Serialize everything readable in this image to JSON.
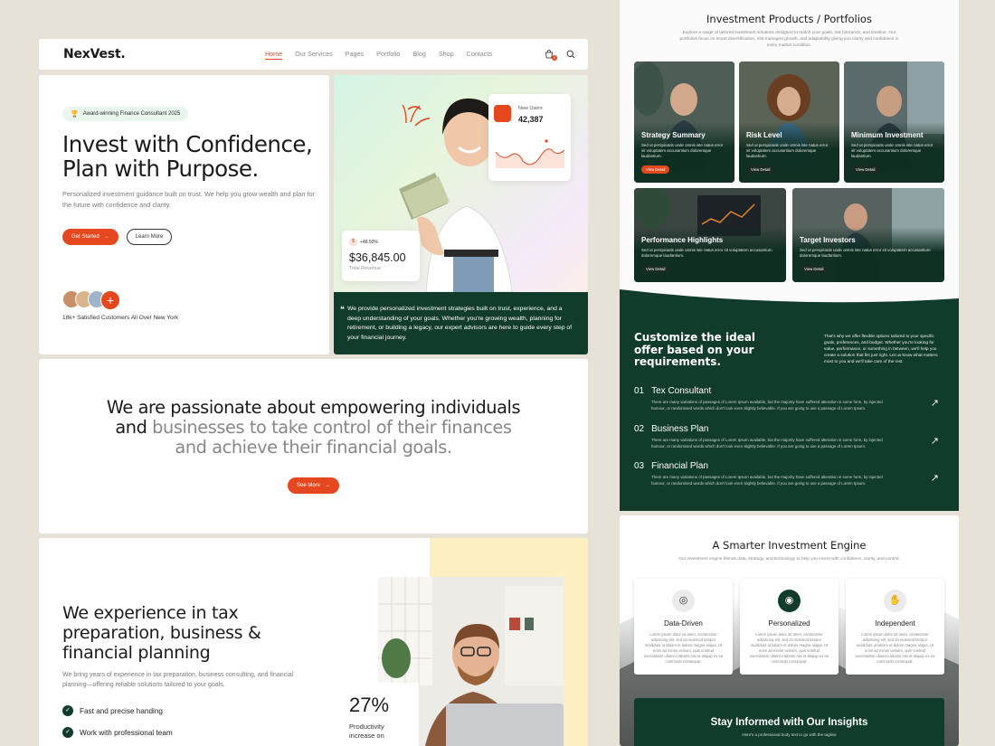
{
  "nav": {
    "logo": "NexVest.",
    "items": [
      {
        "label": "Home",
        "active": true
      },
      {
        "label": "Our Services"
      },
      {
        "label": "Pages"
      },
      {
        "label": "Portfolio"
      },
      {
        "label": "Blog"
      },
      {
        "label": "Shop"
      },
      {
        "label": "Contacts"
      }
    ],
    "cart_count": "0"
  },
  "hero": {
    "badge": "Award-winning Finance Consultant 2025",
    "title_line1": "Invest with Confidence,",
    "title_line2": "Plan with Purpose.",
    "subtitle": "Personalized investment guidance built on trust. We help you grow wealth and plan for the future with confidence and clarity.",
    "primary_btn": "Get Started",
    "secondary_btn": "Learn More",
    "plus_label": "+",
    "customers": "18k+ Satisfied Customers All Over New York",
    "new_users_label": "New Users",
    "new_users_value": "42,387",
    "growth": "+48.50%",
    "coin": "$",
    "revenue": "$36,845.00",
    "revenue_label": "Total Revenue",
    "quote": "We provide personalized investment strategies built on trust, experience, and a deep understanding of your goals. Whether you're growing wealth, planning for retirement, or building a legacy, our expert advisors are here to guide every step of your financial journey."
  },
  "mission": {
    "dark1": "We are passionate about empowering individuals",
    "dark2": "and ",
    "grey2": "businesses to take control of their finances",
    "grey3": "and achieve their financial goals.",
    "btn": "See More"
  },
  "tax": {
    "title_line1": "We experience in tax",
    "title_line2": "preparation, business &",
    "title_line3": "financial planning",
    "subtitle": "We bring years of experience in tax preparation, business consulting, and financial planning—offering reliable solutions tailored to your goals.",
    "checks": [
      "Fast and precise handing",
      "Work with professional team"
    ],
    "stat": "27%",
    "stat_label": "Productivity increase on"
  },
  "products": {
    "title": "Investment Products / Portfolios",
    "subtitle": "Explore a range of tailored investment solutions designed to match your goals, risk tolerance, and timeline. Our portfolios focus on smart diversification, risk-managed growth, and adaptability giving you clarity and confidence in every market condition.",
    "cards": [
      {
        "title": "Strategy Summary",
        "desc": "Sed ut perspiciatis unde omnis iste natus error sit voluptatem accusantium doloremque laudantium.",
        "btn": "View Detail"
      },
      {
        "title": "Risk Level",
        "desc": "Sed ut perspiciatis unde omnis iste natus error sit voluptatem accusantium doloremque laudantium.",
        "btn": "View Detail"
      },
      {
        "title": "Minimum Investment",
        "desc": "Sed ut perspiciatis unde omnis iste natus error sit voluptatem accusantium doloremque laudantium.",
        "btn": "View Detail"
      },
      {
        "title": "Performance Highlights",
        "desc": "Sed ut perspiciatis unde omnis iste natus error sit voluptatem accusantium doloremque laudantium.",
        "btn": "View Detail"
      },
      {
        "title": "Target Investors",
        "desc": "Sed ut perspiciatis unde omnis iste natus error sit voluptatem accusantium doloremque laudantium.",
        "btn": "View Detail"
      }
    ]
  },
  "offer": {
    "title": "Customize the ideal offer based on your requirements.",
    "note": "That's why we offer flexible options tailored to your specific goals, preferences, and budget. Whether you're looking for value, performance, or something in between, we'll help you create a solution that fits just right. Let us know what matters most to you and we'll take care of the rest.",
    "items": [
      {
        "num": "01",
        "title": "Tex Consultant",
        "desc": "There are many variations of passages of Lorem Ipsum available, but the majority have suffered alteration in some form, by injected humour, or randomised words which don't look even slightly believable. If you are going to use a passage of Lorem Ipsum."
      },
      {
        "num": "02",
        "title": "Business Plan",
        "desc": "There are many variations of passages of Lorem Ipsum available, but the majority have suffered alteration in some form, by injected humour, or randomised words which don't look even slightly believable. If you are going to use a passage of Lorem Ipsum."
      },
      {
        "num": "03",
        "title": "Financial Plan",
        "desc": "There are many variations of passages of Lorem Ipsum available, but the majority have suffered alteration in some form, by injected humour, or randomised words which don't look even slightly believable. If you are going to use a passage of Lorem Ipsum."
      }
    ],
    "arrow": "↗"
  },
  "engine": {
    "title": "A Smarter Investment Engine",
    "subtitle": "Our investment engine blends data, strategy, and technology to help you invest with confidence, clarity, and control.",
    "cards": [
      {
        "title": "Data-Driven",
        "desc": "Lorem ipsum dolor sit amet, consectetur adipiscing elit, sed do eiusmod tempor incididunt ut labore et dolore magna aliqua. Ut enim ad minim veniam, quis nostrud exercitation ullamco laboris nisi ut aliquip ex ea commodo consequat."
      },
      {
        "title": "Personalized",
        "desc": "Lorem ipsum dolor sit amet, consectetur adipiscing elit, sed do eiusmod tempor incididunt ut labore et dolore magna aliqua. Ut enim ad minim veniam, quis nostrud exercitation ullamco laboris nisi ut aliquip ex ea commodo consequat."
      },
      {
        "title": "Independent",
        "desc": "Lorem ipsum dolor sit amet, consectetur adipiscing elit, sed do eiusmod tempor incididunt ut labore et dolore magna aliqua. Ut enim ad minim veniam, quis nostrud exercitation ullamco laboris nisi ut aliquip ex ea commodo consequat."
      }
    ],
    "insights_title": "Stay Informed with Our Insights",
    "insights_sub": "Here's a professional body text to go with the tagline"
  },
  "colors": {
    "accent": "#e5471f",
    "dark_green": "#113b2b",
    "yellow": "#fdefc1"
  },
  "icons": [
    "cart-icon",
    "search-icon",
    "trophy-icon",
    "arrow-right-icon",
    "user-icon",
    "check-icon",
    "arrow-up-right-icon",
    "quote-icon"
  ]
}
